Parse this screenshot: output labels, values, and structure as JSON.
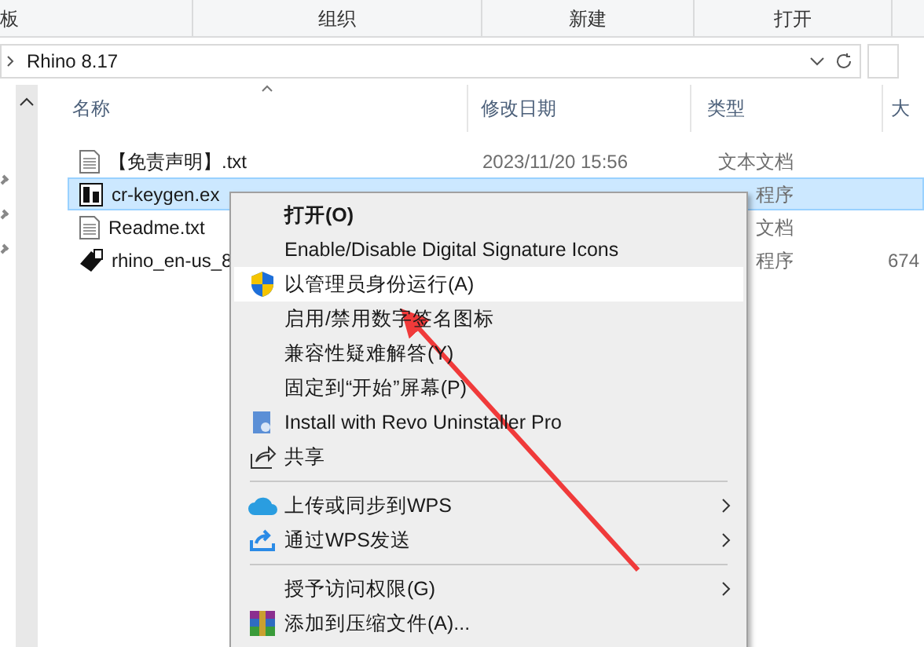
{
  "ribbon": {
    "groups": [
      "板",
      "组织",
      "新建",
      "打开"
    ]
  },
  "address": {
    "path": "Rhino 8.17"
  },
  "columns": [
    "名称",
    "修改日期",
    "类型",
    "大"
  ],
  "files": [
    {
      "kind": "text",
      "name": "【免责声明】.txt",
      "date": "2023/11/20 15:56",
      "type": "文本文档",
      "selected": false
    },
    {
      "kind": "app",
      "name": "cr-keygen.ex",
      "type": "程序",
      "selected": true
    },
    {
      "kind": "text",
      "name": "Readme.txt",
      "type": "文档",
      "selected": false
    },
    {
      "kind": "installer",
      "name": "rhino_en-us_8",
      "type": "程序",
      "size": "674",
      "selected": false
    }
  ],
  "context_menu": {
    "items": [
      {
        "kind": "item",
        "label": "打开(O)",
        "default": true,
        "selected": false,
        "submenu": false
      },
      {
        "kind": "item",
        "label": "Enable/Disable Digital Signature Icons",
        "default": false,
        "selected": false,
        "submenu": false
      },
      {
        "kind": "item",
        "label": "以管理员身份运行(A)",
        "default": false,
        "selected": true,
        "submenu": false
      },
      {
        "kind": "item",
        "label": "启用/禁用数字签名图标",
        "default": false,
        "selected": false,
        "submenu": false
      },
      {
        "kind": "item",
        "label": "兼容性疑难解答(Y)",
        "default": false,
        "selected": false,
        "submenu": false
      },
      {
        "kind": "item",
        "label": "固定到“开始”屏幕(P)",
        "default": false,
        "selected": false,
        "submenu": false
      },
      {
        "kind": "item",
        "label": "Install with Revo Uninstaller Pro",
        "default": false,
        "selected": false,
        "submenu": false
      },
      {
        "kind": "item",
        "label": "共享",
        "default": false,
        "selected": false,
        "submenu": false
      },
      {
        "kind": "separator"
      },
      {
        "kind": "item",
        "label": "上传或同步到WPS",
        "default": false,
        "selected": false,
        "submenu": true
      },
      {
        "kind": "item",
        "label": "通过WPS发送",
        "default": false,
        "selected": false,
        "submenu": true
      },
      {
        "kind": "separator"
      },
      {
        "kind": "item",
        "label": "授予访问权限(G)",
        "default": false,
        "selected": false,
        "submenu": true
      },
      {
        "kind": "item",
        "label": "添加到压缩文件(A)...",
        "default": false,
        "selected": false,
        "submenu": false
      }
    ]
  }
}
